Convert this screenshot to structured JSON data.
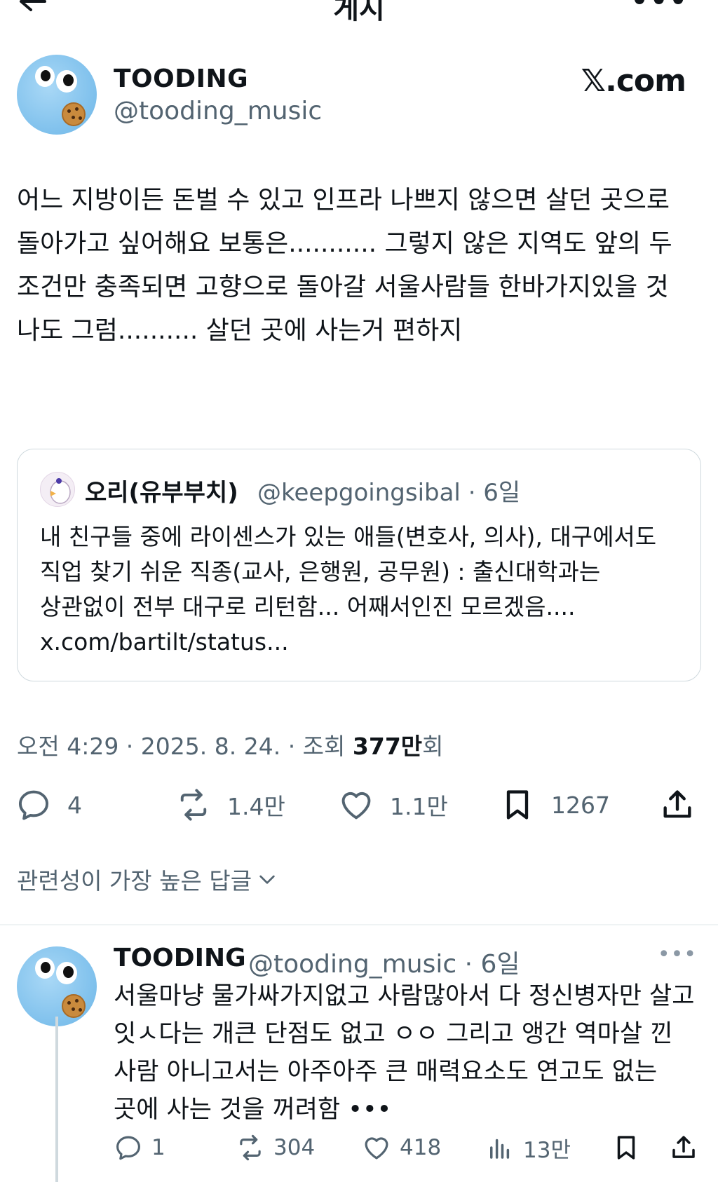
{
  "topbar": {
    "title": "게시",
    "more": "•••"
  },
  "post": {
    "author_name": "TOODING",
    "author_handle": "@tooding_music",
    "brand": "𝕏.com",
    "text": "어느 지방이든 돈벌 수 있고 인프라 나쁘지 않으면 살던 곳으로 돌아가고 싶어해요 보통은........... 그렇지 않은 지역도 앞의 두 조건만 충족되면 고향으로 돌아갈 서울사람들 한바가지있을 것 나도 그럼.......... 살던 곳에 사는거 편하지",
    "quote": {
      "name": "오리(유부부치)",
      "handle_time": "@keepgoingsibal · 6일",
      "text": "내 친구들 중에 라이센스가 있는 애들(변호사, 의사), 대구에서도 직업 찾기 쉬운 직종(교사, 은행원, 공무원) : 출신대학과는 상관없이 전부 대구로 리턴함... 어째서인진 모르겠음.... x.com/bartilt/status..."
    },
    "meta_prefix": "오전 4:29 · 2025. 8. 24. · 조회 ",
    "views_number": "377만",
    "views_suffix": "회",
    "actions": {
      "replies": "4",
      "reposts": "1.4만",
      "likes": "1.1만",
      "bookmarks": "1267"
    }
  },
  "sort_label": "관련성이 가장 높은 답글",
  "reply": {
    "author_name": "TOODING",
    "handle_time": "@tooding_music · 6일",
    "more": "•••",
    "text": "서울마냥 물가싸가지없고 사람많아서 다 정신병자만 살고 잇ㅅ다는 개큰 단점도 없고 ㅇㅇ 그리고 앵간 역마살 낀 사람 아니고서는 아주아주 큰 매력요소도 연고도 없는 곳에 사는 것을 꺼려함 •••",
    "actions": {
      "replies": "1",
      "reposts": "304",
      "likes": "418",
      "views": "13만"
    }
  },
  "colors": {
    "text": "#0f1419",
    "secondary": "#536471",
    "border": "#cfd9de",
    "avatar": "#7ec0ec"
  },
  "icons": [
    "back-arrow-icon",
    "more-icon",
    "reply-icon",
    "repost-icon",
    "like-icon",
    "bookmark-icon",
    "share-icon",
    "views-icon",
    "chevron-down-icon"
  ]
}
